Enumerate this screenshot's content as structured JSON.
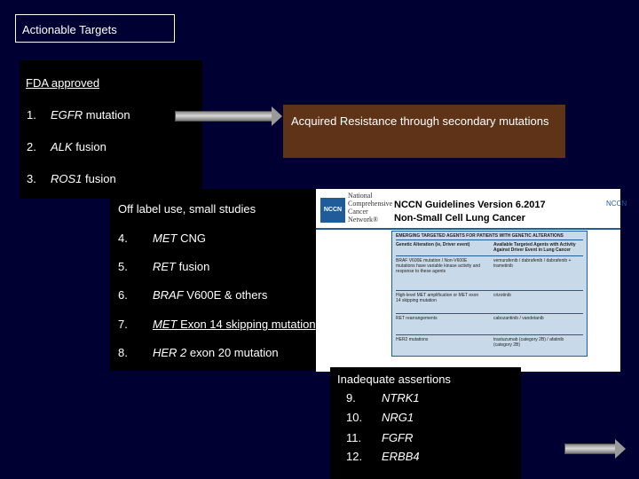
{
  "title": "Actionable Targets",
  "fda": {
    "heading": "FDA approved",
    "items": [
      {
        "num": "1.",
        "gene": "EGFR",
        "desc": " mutation"
      },
      {
        "num": "2.",
        "gene": "ALK",
        "desc": " fusion"
      },
      {
        "num": "3.",
        "gene": "ROS1",
        "desc": " fusion"
      }
    ]
  },
  "resistance": "Acquired Resistance through secondary mutations",
  "off_label": {
    "heading": "Off label use, small studies",
    "items": [
      {
        "num": "4.",
        "gene": "MET",
        "desc": " CNG"
      },
      {
        "num": "5.",
        "gene": "RET",
        "desc": " fusion"
      },
      {
        "num": "6.",
        "gene": "BRAF",
        "desc": " V600E & others"
      },
      {
        "num": "7.",
        "gene": "MET",
        "desc": " Exon 14 skipping mutation"
      },
      {
        "num": "8.",
        "gene": "HER 2",
        "desc": " exon 20 mutation"
      }
    ]
  },
  "nccn": {
    "logo": "NCCN",
    "org": [
      "National",
      "Comprehensive",
      "Cancer",
      "Network®"
    ],
    "title1": "NCCN Guidelines Version 6.2017",
    "title2": "Non-Small Cell Lung Cancer",
    "right": "NCCN",
    "table_header": "EMERGING TARGETED AGENTS FOR PATIENTS WITH GENETIC ALTERATIONS",
    "col1": "Genetic Alteration (ie, Driver event)",
    "col2": "Available Targeted Agents with Activity Against Driver Event in Lung Cancer",
    "rows": [
      {
        "a": "BRAF V600E mutation / Non-V600E mutations have variable kinase activity and response to these agents",
        "b": "vemurafenib / dabrafenib / dabrafenib + trametinib"
      },
      {
        "a": "High-level MET amplification or MET exon 14 skipping mutation",
        "b": "crizotinib"
      },
      {
        "a": "RET rearrangements",
        "b": "cabozantinib / vandetanib"
      },
      {
        "a": "HER2 mutations",
        "b": "trastuzumab (category 2B) / afatinib (category 2B)"
      }
    ]
  },
  "inadequate": {
    "heading": "Inadequate assertions",
    "items": [
      {
        "num": "9.",
        "gene": "NTRK1"
      },
      {
        "num": "10.",
        "gene": "NRG1"
      },
      {
        "num": "11.",
        "gene": "FGFR"
      },
      {
        "num": "12.",
        "gene": "ERBB4"
      }
    ]
  }
}
